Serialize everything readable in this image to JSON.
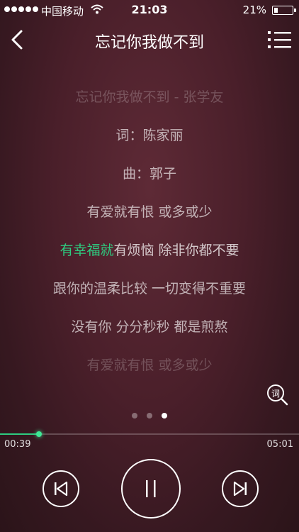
{
  "status_bar": {
    "carrier": "中国移动",
    "time": "21:03",
    "battery_percent": "21%",
    "battery_level": 0.21,
    "signal_dots": 5
  },
  "nav": {
    "title": "忘记你我做不到",
    "back_icon": "chevron-left-icon",
    "playlist_icon": "list-icon"
  },
  "lyrics": {
    "lines": [
      "忘记你我做不到 - 张学友",
      "词：陈家丽",
      "曲：郭子",
      "有爱就有恨 或多或少"
    ],
    "active_sung": "有幸福就",
    "active_unsung": "有烦恼 除非你都不要",
    "lines_after": [
      "跟你的温柔比较 一切变得不重要",
      "没有你 分分秒秒 都是煎熬",
      "有爱就有恨 或多或少"
    ],
    "search_icon": "lyrics-search-icon",
    "search_icon_char": "词"
  },
  "pager": {
    "pages": 3,
    "current": 3
  },
  "player": {
    "elapsed": "00:39",
    "total": "05:01",
    "progress_fraction": 0.13,
    "state": "playing",
    "accent_color": "#2ecc80",
    "prev_icon": "skip-previous-icon",
    "pause_icon": "pause-icon",
    "next_icon": "skip-next-icon"
  }
}
